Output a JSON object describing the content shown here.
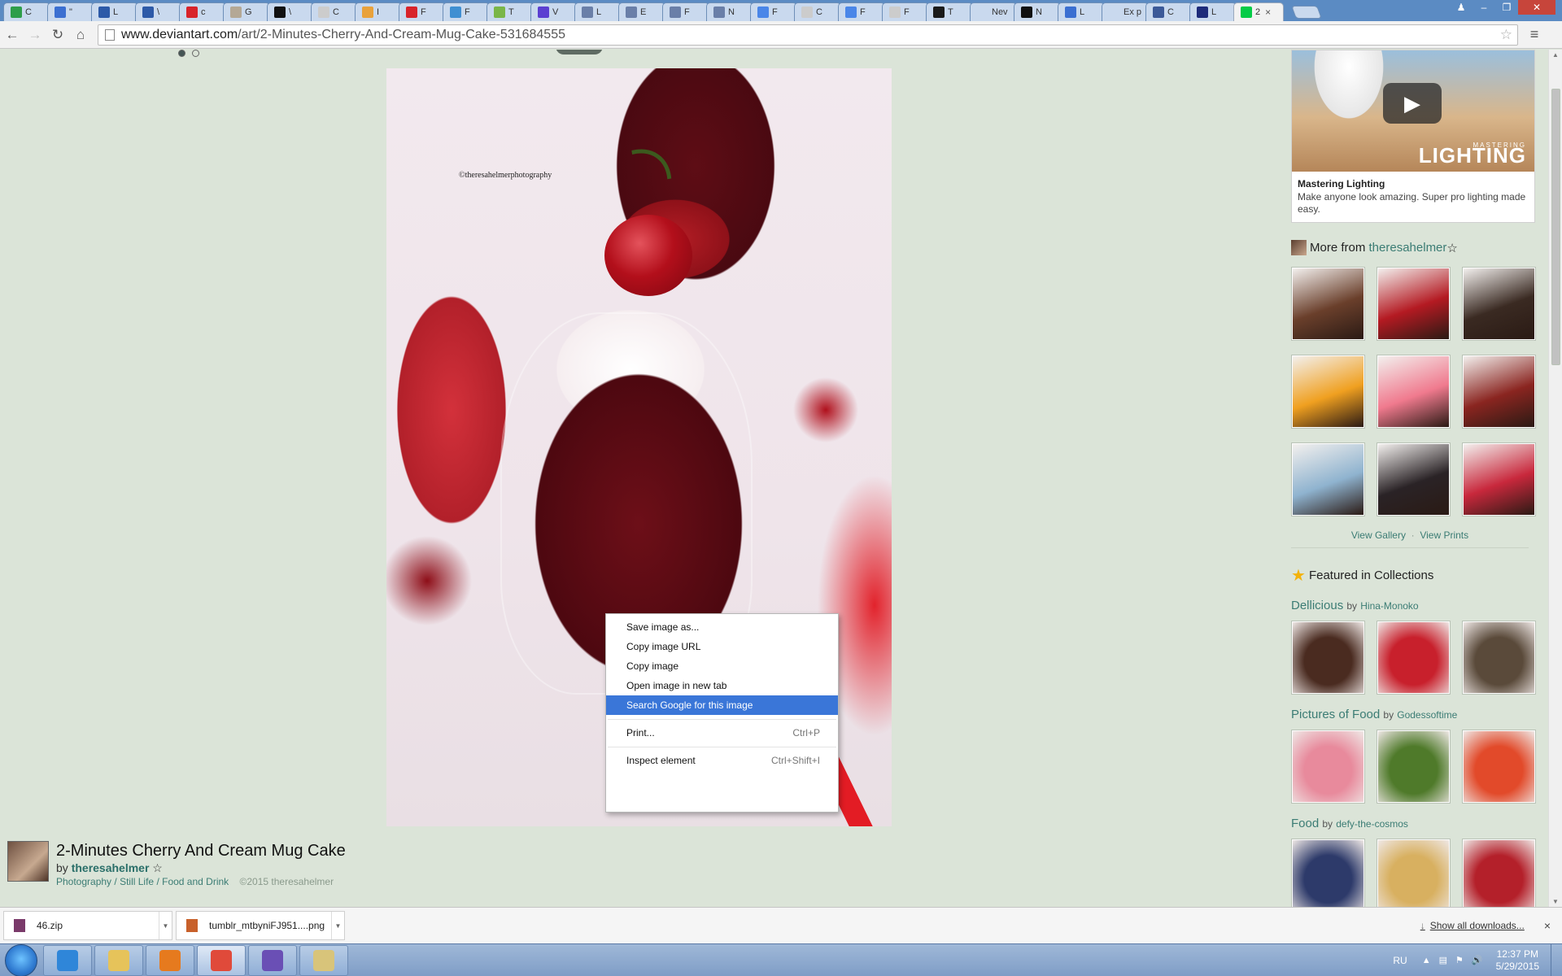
{
  "browser": {
    "tabs": [
      {
        "label": "C",
        "fav_color": "#2e9e4a"
      },
      {
        "label": "\"",
        "fav_color": "#3b6fd1"
      },
      {
        "label": "L",
        "fav_color": "#2d5aa8"
      },
      {
        "label": "\\",
        "fav_color": "#2d5aa8"
      },
      {
        "label": "c",
        "fav_color": "#d8232a"
      },
      {
        "label": "G",
        "fav_color": "#b4a895"
      },
      {
        "label": "\\",
        "fav_color": "#111111"
      },
      {
        "label": "C",
        "fav_color": "#cccccc"
      },
      {
        "label": "I",
        "fav_color": "#e9a23b"
      },
      {
        "label": "F",
        "fav_color": "#d8232a"
      },
      {
        "label": "F",
        "fav_color": "#3f8fd2"
      },
      {
        "label": "T",
        "fav_color": "#7ab648"
      },
      {
        "label": "V",
        "fav_color": "#5b3fd1"
      },
      {
        "label": "L",
        "fav_color": "#6a7fa8"
      },
      {
        "label": "E",
        "fav_color": "#6a7fa8"
      },
      {
        "label": "F",
        "fav_color": "#6a7fa8"
      },
      {
        "label": "N",
        "fav_color": "#6a7fa8"
      },
      {
        "label": "F",
        "fav_color": "#4a86e8"
      },
      {
        "label": "C",
        "fav_color": "#cccccc"
      },
      {
        "label": "F",
        "fav_color": "#4a86e8"
      },
      {
        "label": "F",
        "fav_color": "#cccccc"
      },
      {
        "label": "T",
        "fav_color": "#1a1a1a"
      },
      {
        "label": "Nev",
        "fav_color": "#c9d9ee"
      },
      {
        "label": "N",
        "fav_color": "#111111"
      },
      {
        "label": "L",
        "fav_color": "#3b6fd1"
      },
      {
        "label": "Ex p",
        "fav_color": "#c9d9ee"
      },
      {
        "label": "C",
        "fav_color": "#3b5998"
      },
      {
        "label": "L",
        "fav_color": "#1d2b7a"
      },
      {
        "label": "2",
        "fav_color": "#05cc47",
        "active": true
      }
    ],
    "url_host": "www.deviantart.com",
    "url_path": "/art/2-Minutes-Cherry-And-Cream-Mug-Cake-531684555",
    "close_tab": "×"
  },
  "context_menu": {
    "items": [
      {
        "label": "Save image as...",
        "shortcut": ""
      },
      {
        "label": "Copy image URL",
        "shortcut": ""
      },
      {
        "label": "Copy image",
        "shortcut": ""
      },
      {
        "label": "Open image in new tab",
        "shortcut": ""
      },
      {
        "label": "Search Google for this image",
        "shortcut": "",
        "highlighted": true
      },
      {
        "label": "Print...",
        "shortcut": "Ctrl+P"
      },
      {
        "label": "Inspect element",
        "shortcut": "Ctrl+Shift+I"
      }
    ]
  },
  "artwork": {
    "watermark": "©theresahelmerphotography",
    "title": "2-Minutes Cherry And Cream Mug Cake",
    "by_label": "by",
    "author": "theresahelmer",
    "author_star": "☆",
    "category_1": "Photography",
    "category_2": "Still Life",
    "category_3": "Food and Drink",
    "category_sep": " / ",
    "copyright": "©2015 theresahelmer"
  },
  "sidebar": {
    "ad": {
      "overlay_small": "MASTERING",
      "overlay_big": "LIGHTING",
      "title": "Mastering Lighting",
      "text": "Make anyone look amazing. Super pro lighting made easy."
    },
    "more_from_label": "More from",
    "more_from_author": "theresahelmer",
    "more_from_star": "☆",
    "more_thumbs": [
      "#6a3f2b",
      "#b41a22",
      "#3a2a22",
      "#f0a020",
      "#f07a8e",
      "#8a2520",
      "#8fb3cf",
      "#2a2326",
      "#c8283c"
    ],
    "view_gallery": "View Gallery",
    "link_sep": "·",
    "view_prints": "View Prints",
    "featured_label": "Featured in Collections",
    "collections": [
      {
        "title": "Dellicious",
        "by": "by",
        "owner": "Hina-Monoko",
        "thumbs": [
          "#4a2b20",
          "#c8202c",
          "#5a4a3a"
        ]
      },
      {
        "title": "Pictures of Food",
        "by": "by",
        "owner": "Godessoftime",
        "thumbs": [
          "#e88a9c",
          "#4f7a2a",
          "#e24a2a"
        ]
      },
      {
        "title": "Food",
        "by": "by",
        "owner": "defy-the-cosmos",
        "thumbs": [
          "#2d3a6a",
          "#d8b060",
          "#b4202a"
        ]
      }
    ]
  },
  "downloads": {
    "items": [
      {
        "name": "46.zip",
        "icon_color": "#7a3a6a"
      },
      {
        "name": "tumblr_mtbyniFJ951....png",
        "icon_color": "#c8602a"
      }
    ],
    "show_all": "Show all downloads...",
    "close": "×"
  },
  "taskbar": {
    "apps": [
      {
        "name": "internet-explorer",
        "color": "#2f86d9"
      },
      {
        "name": "file-explorer",
        "color": "#e6c35a"
      },
      {
        "name": "media-player",
        "color": "#e67a1e"
      },
      {
        "name": "chrome",
        "color": "#e04a3a",
        "active": true
      },
      {
        "name": "php-storm",
        "color": "#6a4fb5"
      },
      {
        "name": "paint",
        "color": "#d8c47a"
      }
    ],
    "lang": "RU",
    "time": "12:37 PM",
    "date": "5/29/2015"
  }
}
